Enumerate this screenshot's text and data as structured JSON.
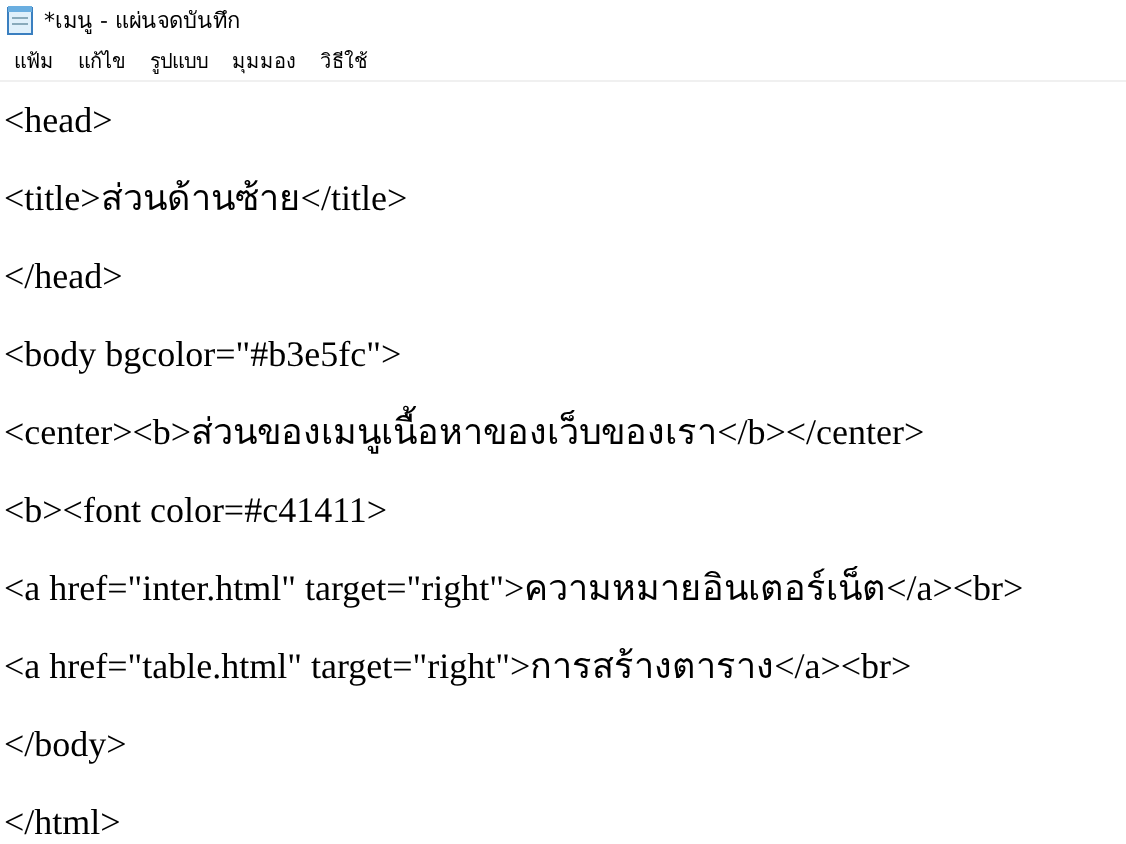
{
  "window": {
    "title": "*เมนู - แผ่นจดบันทึก"
  },
  "menu": [
    "แฟ้ม",
    "แก้ไข",
    "รูปแบบ",
    "มุมมอง",
    "วิธีใช้"
  ],
  "editor": {
    "lines": [
      "<head>",
      "<title>ส่วนด้านซ้าย</title>",
      "</head>",
      "<body bgcolor=\"#b3e5fc\">",
      "<center><b>ส่วนของเมนูเนื้อหาของเว็บของเรา</b></center>",
      "<b><font color=#c41411>",
      "<a href=\"inter.html\" target=\"right\">ความหมายอินเตอร์เน็ต</a><br>",
      "<a href=\"table.html\" target=\"right\">การสร้างตาราง</a><br>",
      "</body>",
      "</html>"
    ]
  }
}
